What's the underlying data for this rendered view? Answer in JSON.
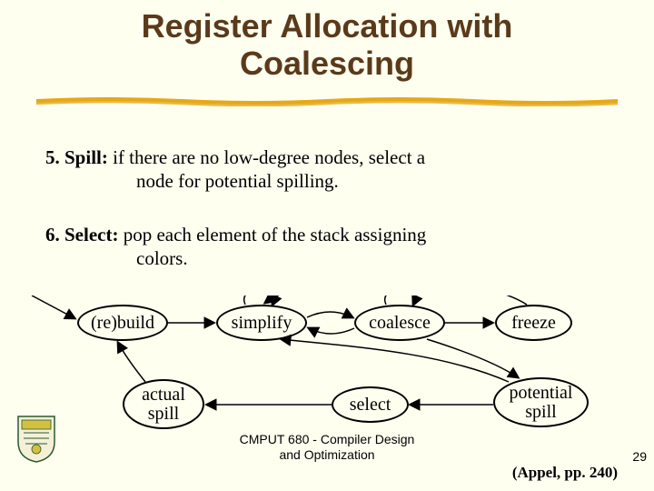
{
  "title_line1": "Register Allocation with",
  "title_line2": "Coalescing",
  "items": {
    "five": {
      "label": "5. Spill:",
      "text_a": " if there are no low-degree nodes, select a",
      "text_b": "node for potential spilling."
    },
    "six": {
      "label": "6. Select:",
      "text_a": " pop each element of the stack assigning",
      "text_b": "colors."
    }
  },
  "nodes": {
    "rebuild": "(re)build",
    "simplify": "simplify",
    "coalesce": "coalesce",
    "freeze": "freeze",
    "actual_spill": "actual\nspill",
    "select": "select",
    "potential_spill": "potential\nspill"
  },
  "footer": {
    "course_line1": "CMPUT 680 - Compiler Design",
    "course_line2": "and Optimization",
    "citation": "(Appel, pp. 240)",
    "page": "29"
  }
}
